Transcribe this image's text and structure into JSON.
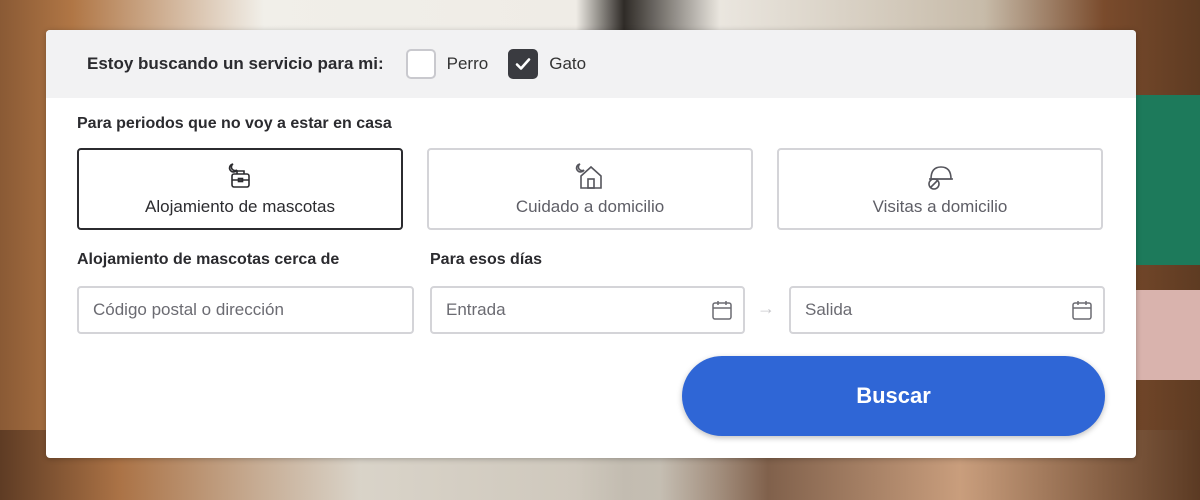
{
  "pet_selector": {
    "question": "Estoy buscando un servicio para mi:",
    "options": [
      {
        "label": "Perro",
        "checked": false
      },
      {
        "label": "Gato",
        "checked": true
      }
    ]
  },
  "services": {
    "section_label": "Para periodos que no voy a estar en casa",
    "items": [
      {
        "label": "Alojamiento de mascotas",
        "icon": "pet-boarding-icon",
        "selected": true
      },
      {
        "label": "Cuidado a domicilio",
        "icon": "house-sitting-icon",
        "selected": false
      },
      {
        "label": "Visitas a domicilio",
        "icon": "drop-in-visits-icon",
        "selected": false
      }
    ]
  },
  "location": {
    "label": "Alojamiento de mascotas cerca de",
    "placeholder": "Código postal o dirección"
  },
  "dates": {
    "label": "Para esos días",
    "start_placeholder": "Entrada",
    "end_placeholder": "Salida",
    "arrow": "→"
  },
  "search_button": {
    "label": "Buscar"
  },
  "colors": {
    "accent": "#2f66d6",
    "selected_border": "#2b2b2f",
    "checkbox_checked": "#3a3b40"
  }
}
